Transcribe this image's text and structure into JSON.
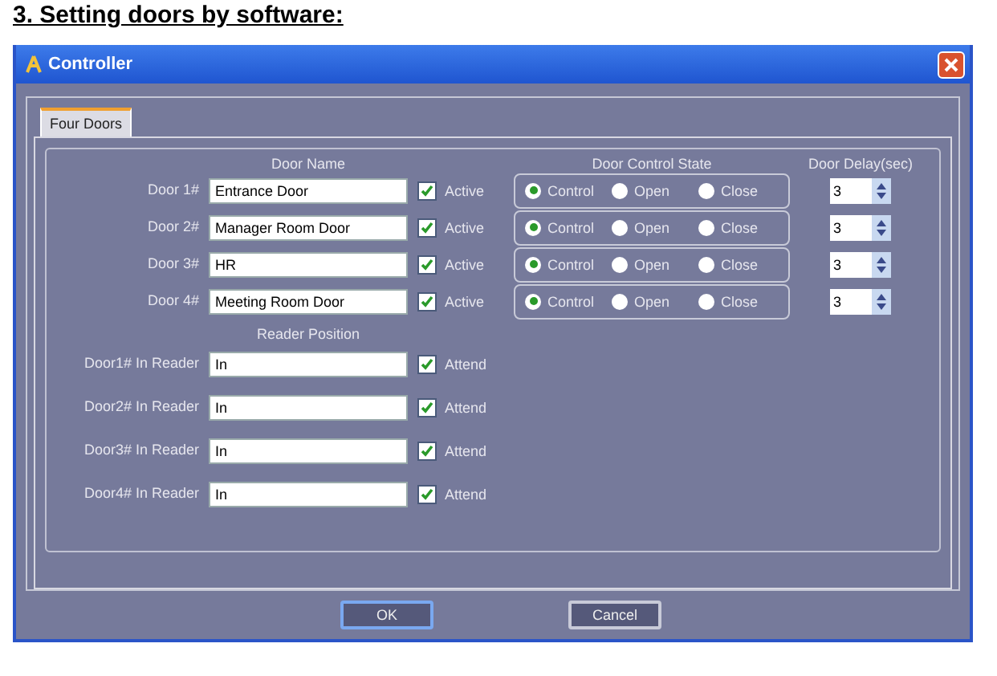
{
  "heading": "3. Setting doors by software:",
  "window": {
    "title": "Controller"
  },
  "tabs": [
    {
      "label": "Four Doors",
      "selected": true
    }
  ],
  "door_section": {
    "name_header": "Door Name",
    "state_header": "Door Control State",
    "delay_header": "Door Delay(sec)"
  },
  "doors": [
    {
      "label": "Door 1#",
      "name": "Entrance Door",
      "active_label": "Active",
      "active": true,
      "states": [
        {
          "label": "Control",
          "selected": true
        },
        {
          "label": "Open",
          "selected": false
        },
        {
          "label": "Close",
          "selected": false
        }
      ],
      "delay": "3"
    },
    {
      "label": "Door 2#",
      "name": "Manager Room Door",
      "active_label": "Active",
      "active": true,
      "states": [
        {
          "label": "Control",
          "selected": true
        },
        {
          "label": "Open",
          "selected": false
        },
        {
          "label": "Close",
          "selected": false
        }
      ],
      "delay": "3"
    },
    {
      "label": "Door 3#",
      "name": "HR",
      "active_label": "Active",
      "active": true,
      "states": [
        {
          "label": "Control",
          "selected": true
        },
        {
          "label": "Open",
          "selected": false
        },
        {
          "label": "Close",
          "selected": false
        }
      ],
      "delay": "3"
    },
    {
      "label": "Door 4#",
      "name": "Meeting Room Door",
      "active_label": "Active",
      "active": true,
      "states": [
        {
          "label": "Control",
          "selected": true
        },
        {
          "label": "Open",
          "selected": false
        },
        {
          "label": "Close",
          "selected": false
        }
      ],
      "delay": "3"
    }
  ],
  "reader_section": {
    "header": "Reader Position"
  },
  "readers": [
    {
      "label": "Door1# In Reader",
      "position": "In",
      "attend_label": "Attend",
      "attend": true
    },
    {
      "label": "Door2# In Reader",
      "position": "In",
      "attend_label": "Attend",
      "attend": true
    },
    {
      "label": "Door3# In Reader",
      "position": "In",
      "attend_label": "Attend",
      "attend": true
    },
    {
      "label": "Door4# In Reader",
      "position": "In",
      "attend_label": "Attend",
      "attend": true
    }
  ],
  "buttons": [
    {
      "label": "OK",
      "focused": true
    },
    {
      "label": "Cancel",
      "focused": false
    }
  ]
}
